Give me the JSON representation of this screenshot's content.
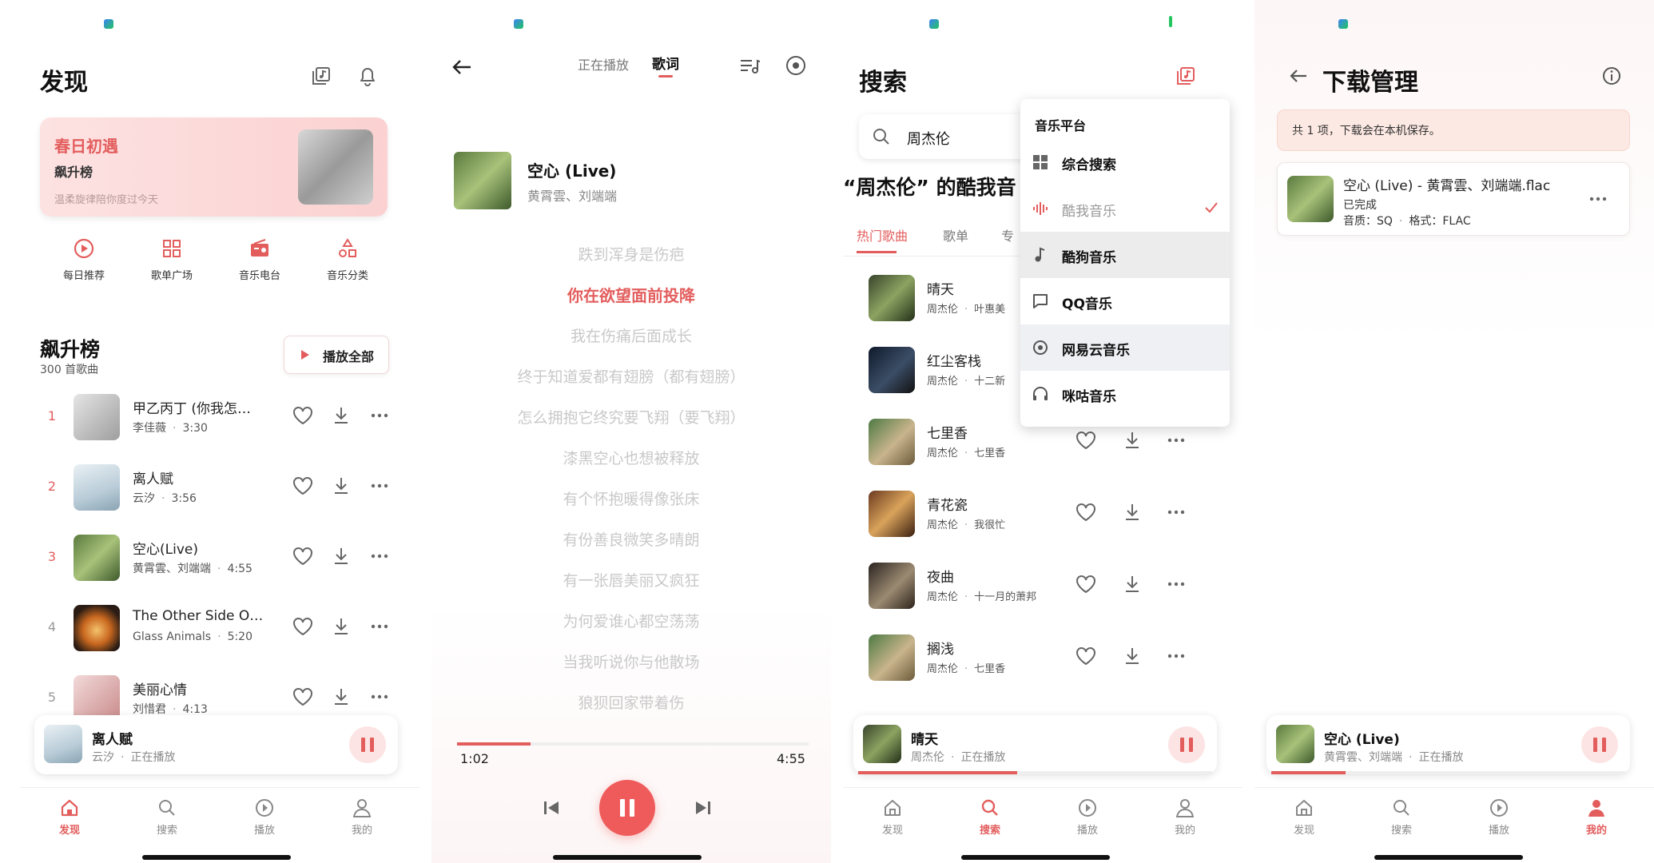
{
  "discover": {
    "title": "发现",
    "banner": {
      "title": "春日初遇",
      "subtitle": "飙升榜",
      "desc": "温柔旋律陪你度过今天"
    },
    "quick": [
      "每日推荐",
      "歌单广场",
      "音乐电台",
      "音乐分类"
    ],
    "chart_title": "飙升榜",
    "chart_count": "300 首歌曲",
    "play_all": "播放全部",
    "songs": [
      {
        "rank": "1",
        "title": "甲乙丙丁 (你我怎…",
        "artist": "李佳薇",
        "duration": "3:30"
      },
      {
        "rank": "2",
        "title": "离人赋",
        "artist": "云汐",
        "duration": "3:56"
      },
      {
        "rank": "3",
        "title": "空心(Live)",
        "artist": "黄霄雲、刘端端",
        "duration": "4:55"
      },
      {
        "rank": "4",
        "title": "The Other Side O…",
        "artist": "Glass Animals",
        "duration": "5:20"
      },
      {
        "rank": "5",
        "title": "美丽心情",
        "artist": "刘惜君",
        "duration": "4:13"
      }
    ],
    "mini": {
      "title": "离人赋",
      "artist": "云汐",
      "status": "正在播放"
    }
  },
  "player": {
    "tabs": [
      "正在播放",
      "歌词"
    ],
    "song_title": "空心 (Live)",
    "song_artist": "黄霄雲、刘端端",
    "lyrics": [
      "跌到浑身是伤疤",
      "你在欲望面前投降",
      "我在伤痛后面成长",
      "终于知道爱都有翅膀（都有翅膀）",
      "怎么拥抱它终究要飞翔（要飞翔）",
      "漆黑空心也想被释放",
      "有个怀抱暖得像张床",
      "有份善良微笑多晴朗",
      "有一张唇美丽又疯狂",
      "为何爱谁心都空荡荡",
      "当我听说你与他散场",
      "狼狈回家带着伤"
    ],
    "time_current": "1:02",
    "time_total": "4:55",
    "progress": 0.21
  },
  "search": {
    "title": "搜索",
    "query": "周杰伦",
    "heading": "“周杰伦” 的酷我音",
    "tabs": [
      "热门歌曲",
      "歌单",
      "专"
    ],
    "songs": [
      {
        "title": "晴天",
        "artist": "周杰伦",
        "album": "叶惠美"
      },
      {
        "title": "红尘客栈",
        "artist": "周杰伦",
        "album": "十二新"
      },
      {
        "title": "七里香",
        "artist": "周杰伦",
        "album": "七里香"
      },
      {
        "title": "青花瓷",
        "artist": "周杰伦",
        "album": "我很忙"
      },
      {
        "title": "夜曲",
        "artist": "周杰伦",
        "album": "十一月的萧邦"
      },
      {
        "title": "搁浅",
        "artist": "周杰伦",
        "album": "七里香"
      }
    ],
    "dropdown": {
      "header": "音乐平台",
      "items": [
        "综合搜索",
        "酷我音乐",
        "酷狗音乐",
        "QQ音乐",
        "网易云音乐",
        "咪咕音乐"
      ],
      "checked": "酷我音乐"
    },
    "mini": {
      "title": "晴天",
      "artist": "周杰伦",
      "status": "正在播放"
    }
  },
  "downloads": {
    "title": "下载管理",
    "notice": "共 1 项，下载会在本机保存。",
    "item": {
      "filename": "空心 (Live) - 黄霄雲、刘端端.flac",
      "status": "已完成",
      "quality_label": "音质：SQ",
      "format_label": "格式：FLAC"
    },
    "mini": {
      "title": "空心 (Live)",
      "artist": "黄霄雲、刘端端",
      "status": "正在播放"
    }
  },
  "nav": [
    "发现",
    "搜索",
    "播放",
    "我的"
  ],
  "colors": {
    "accent": "#e35d5d",
    "muted": "#888888"
  }
}
